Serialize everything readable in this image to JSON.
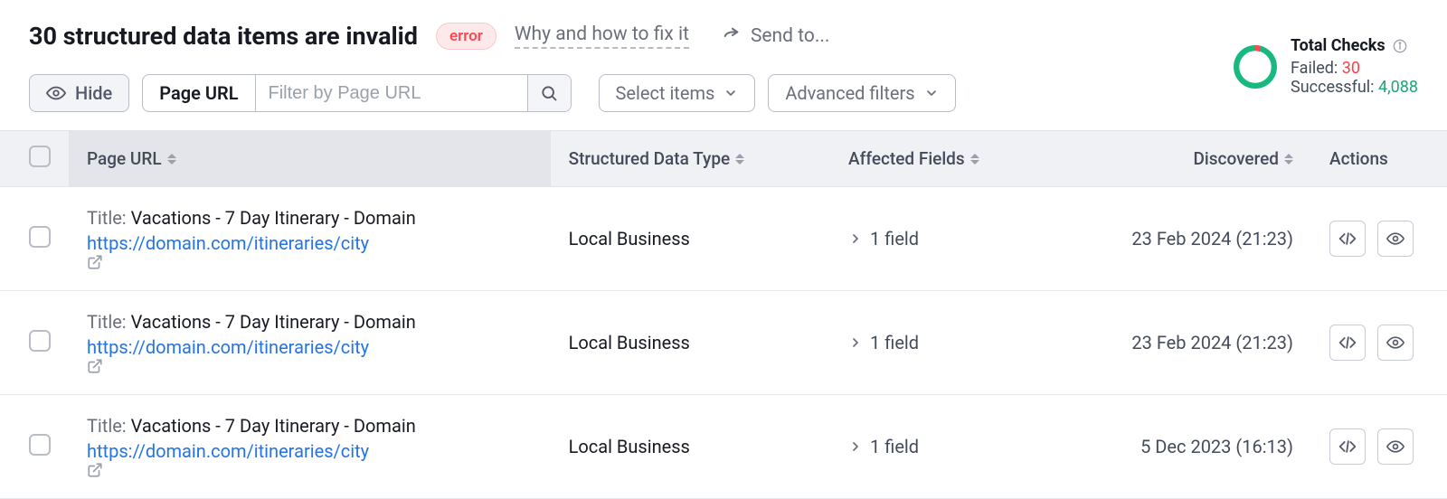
{
  "header": {
    "title": "30 structured data items are invalid",
    "error_badge": "error",
    "fix_link": "Why and how to fix it",
    "send_to": "Send to..."
  },
  "controls": {
    "hide_btn": "Hide",
    "url_filter_label": "Page URL",
    "url_filter_placeholder": "Filter by Page URL",
    "select_items": "Select items",
    "advanced_filters": "Advanced filters"
  },
  "total_checks": {
    "title": "Total Checks",
    "failed_label": "Failed: ",
    "failed_value": "30",
    "success_label": "Successful: ",
    "success_value": "4,088"
  },
  "table": {
    "columns": {
      "page_url": "Page URL",
      "data_type": "Structured Data Type",
      "affected": "Affected Fields",
      "discovered": "Discovered",
      "actions": "Actions"
    },
    "title_prefix": "Title: ",
    "rows": [
      {
        "title": "Vacations - 7 Day Itinerary - Domain",
        "url": "https://domain.com/itineraries/city",
        "data_type": "Local Business",
        "affected": "1 field",
        "discovered": "23 Feb 2024 (21:23)"
      },
      {
        "title": "Vacations - 7 Day Itinerary - Domain",
        "url": "https://domain.com/itineraries/city",
        "data_type": "Local Business",
        "affected": "1 field",
        "discovered": "23 Feb 2024 (21:23)"
      },
      {
        "title": "Vacations - 7 Day Itinerary - Domain",
        "url": "https://domain.com/itineraries/city",
        "data_type": "Local Business",
        "affected": "1 field",
        "discovered": "5 Dec 2023 (16:13)"
      }
    ]
  }
}
